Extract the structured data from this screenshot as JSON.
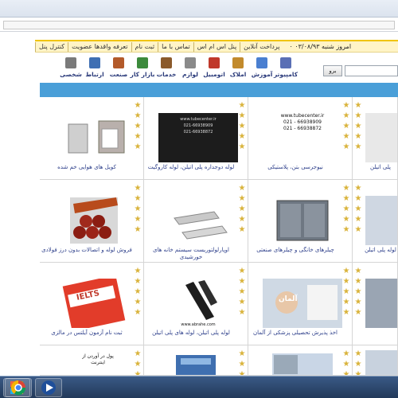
{
  "topnav": {
    "items": [
      "کنترل پنل",
      "تعرفه واقدها عضویت",
      "ثبت نام",
      "تماس با ما",
      "پنل اس ام اس",
      "پرداخت آنلاین"
    ],
    "date": "امروز  شنبه  ۰۳/۰۸/۹۳ ۰"
  },
  "search": {
    "button_label": "برو",
    "placeholder": ""
  },
  "categories": [
    "کامپیوتر",
    "آموزش",
    "املاک",
    "اتومبیل",
    "لوازم",
    "خدمات",
    "بازار کار",
    "صنعت",
    "ارتباط",
    "شخصی"
  ],
  "category_colors": [
    "#5a6fb5",
    "#4a7fd0",
    "#c28a2c",
    "#c0392b",
    "#8a8a8a",
    "#8b5a2b",
    "#3c8a3c",
    "#b35a2a",
    "#3f6fb3",
    "#7a7a7a"
  ],
  "listings": [
    {
      "caption": "کویل های هوایی خم شده",
      "thumb": "coil-icon",
      "photo_text": ""
    },
    {
      "caption": "لوله دوجداره پلی اتیلن، لوله کاروگیت",
      "thumb": "pipe-dark-icon",
      "photo_text": "www.tubecenter.ir\n021-66938909\n021-66938872"
    },
    {
      "caption": "نیوجرسی بتن، پلاستیکی",
      "thumb": "barrier-icon",
      "photo_text": "www.tubecenter.ir\n021 - 66938909\n021 - 66938872"
    },
    {
      "caption": "پلی اتیلن",
      "thumb": "pipes-white-icon",
      "photo_text": ""
    },
    {
      "caption": "فروش لوله و اتصالات بدون درز فولادی",
      "thumb": "steel-pipes-icon",
      "photo_text": ""
    },
    {
      "caption": "اوپارلولتوریست سیستم خانه های خورشیدی",
      "thumb": "ducts-icon",
      "photo_text": ""
    },
    {
      "caption": "چیلرهای خانگی و چیلرهای صنعتی",
      "thumb": "chiller-icon",
      "photo_text": ""
    },
    {
      "caption": "لوله پلی اتیلن",
      "thumb": "pipe-blue-icon",
      "photo_text": ""
    },
    {
      "caption": "ثبت نام آزمون آیلتس در مالزی",
      "thumb": "ielts-icon",
      "photo_text": "IELTS"
    },
    {
      "caption": "لوله پلی اتیلن، لوله های پلی اتیلن",
      "thumb": "hdpe-pipe-icon",
      "photo_text": "www.abrahe.com"
    },
    {
      "caption": "اخذ پذیرش تحصیلی پزشکی از آلمان",
      "thumb": "germany-icon",
      "photo_text": "آلمان"
    },
    {
      "caption": "",
      "thumb": "machine-icon",
      "photo_text": ""
    },
    {
      "caption": "",
      "thumb": "chinese-text-icon",
      "photo_text": "پول در آوردن از اینترنت"
    },
    {
      "caption": "",
      "thumb": "box-icon",
      "photo_text": ""
    },
    {
      "caption": "",
      "thumb": "medical-icon",
      "photo_text": ""
    },
    {
      "caption": "",
      "thumb": "partial-icon",
      "photo_text": ""
    }
  ],
  "taskbar": {
    "buttons": [
      "start-icon",
      "chrome-icon",
      "media-icon"
    ]
  },
  "colors": {
    "accent_bar": "#4a9fd8",
    "nav_bg": "#fff4c6",
    "nav_border": "#f0c400",
    "caption": "#2c3e8a",
    "star": "#d9b33b"
  }
}
